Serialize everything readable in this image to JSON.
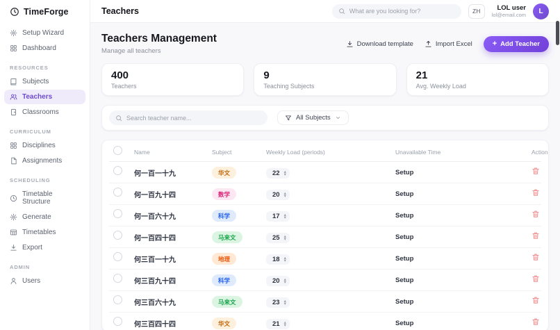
{
  "app": {
    "name": "TimeForge"
  },
  "sidebar": {
    "sections": [
      {
        "label": "",
        "items": [
          {
            "label": "Setup Wizard",
            "icon": "gear"
          },
          {
            "label": "Dashboard",
            "icon": "dashboard"
          }
        ]
      },
      {
        "label": "RESOURCES",
        "items": [
          {
            "label": "Subjects",
            "icon": "book"
          },
          {
            "label": "Teachers",
            "icon": "people",
            "active": true
          },
          {
            "label": "Classrooms",
            "icon": "door"
          }
        ]
      },
      {
        "label": "CURRICULUM",
        "items": [
          {
            "label": "Disciplines",
            "icon": "grid"
          },
          {
            "label": "Assignments",
            "icon": "doc"
          }
        ]
      },
      {
        "label": "SCHEDULING",
        "items": [
          {
            "label": "Timetable Structure",
            "icon": "clock"
          },
          {
            "label": "Generate",
            "icon": "gear"
          },
          {
            "label": "Timetables",
            "icon": "table"
          },
          {
            "label": "Export",
            "icon": "download"
          }
        ]
      },
      {
        "label": "ADMIN",
        "items": [
          {
            "label": "Users",
            "icon": "person"
          }
        ]
      }
    ]
  },
  "header": {
    "title": "Teachers",
    "search_placeholder": "What are you looking for?",
    "language": "ZH",
    "user": {
      "name": "LOL user",
      "email": "lol@email.com",
      "avatar_initial": "L"
    }
  },
  "page": {
    "title": "Teachers Management",
    "subtitle": "Manage all teachers",
    "actions": {
      "download_template": "Download template",
      "import_excel": "Import Excel",
      "add_teacher": "Add Teacher"
    }
  },
  "stats": [
    {
      "value": "400",
      "label": "Teachers"
    },
    {
      "value": "9",
      "label": "Teaching Subjects"
    },
    {
      "value": "21",
      "label": "Avg. Weekly Load"
    }
  ],
  "filters": {
    "search_placeholder": "Search teacher name...",
    "subject_filter": "All Subjects"
  },
  "table": {
    "columns": [
      "Name",
      "Subject",
      "Weekly Load (periods)",
      "Unavailable Time",
      "Actions"
    ],
    "rows": [
      {
        "name": "何一百一十九",
        "subject": "华文",
        "subject_color": "amber",
        "weekly_load": "22",
        "unavailable": "Setup"
      },
      {
        "name": "何一百九十四",
        "subject": "数学",
        "subject_color": "pink",
        "weekly_load": "20",
        "unavailable": "Setup"
      },
      {
        "name": "何一百六十九",
        "subject": "科学",
        "subject_color": "blue",
        "weekly_load": "17",
        "unavailable": "Setup"
      },
      {
        "name": "何一百四十四",
        "subject": "马来文",
        "subject_color": "green",
        "weekly_load": "25",
        "unavailable": "Setup"
      },
      {
        "name": "何三百一十九",
        "subject": "地理",
        "subject_color": "orange",
        "weekly_load": "18",
        "unavailable": "Setup"
      },
      {
        "name": "何三百九十四",
        "subject": "科学",
        "subject_color": "blue",
        "weekly_load": "20",
        "unavailable": "Setup"
      },
      {
        "name": "何三百六十九",
        "subject": "马来文",
        "subject_color": "green",
        "weekly_load": "23",
        "unavailable": "Setup"
      },
      {
        "name": "何三百四十四",
        "subject": "华文",
        "subject_color": "amber",
        "weekly_load": "21",
        "unavailable": "Setup"
      }
    ]
  },
  "theme": {
    "accent": "#7040d8",
    "subject_colors": {
      "amber": {
        "bg": "#fdf0dc",
        "fg": "#c2660a"
      },
      "pink": {
        "bg": "#fce7f3",
        "fg": "#db2777"
      },
      "blue": {
        "bg": "#dfeafd",
        "fg": "#2563eb"
      },
      "green": {
        "bg": "#dcf5e3",
        "fg": "#16a34a"
      },
      "orange": {
        "bg": "#ffe9d5",
        "fg": "#ea580c"
      }
    }
  }
}
